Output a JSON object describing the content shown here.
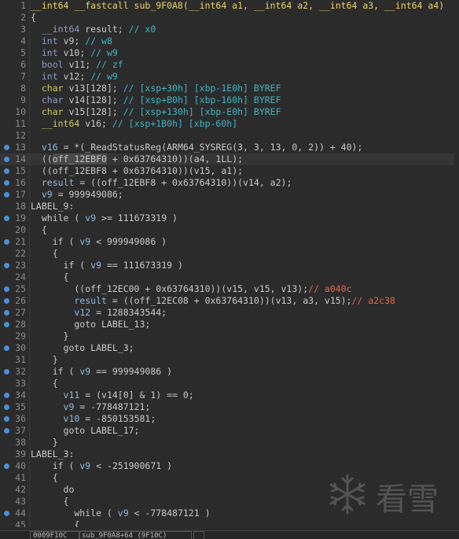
{
  "editor": {
    "lines": [
      {
        "n": "1",
        "dot": false,
        "hl": false,
        "tokens": [
          [
            "fn",
            "__int64 __fastcall sub_9F0A8(__int64 a1, __int64 a2, __int64 a3, __int64 a4)"
          ]
        ]
      },
      {
        "n": "2",
        "dot": false,
        "hl": false,
        "tokens": [
          [
            "",
            "{"
          ]
        ]
      },
      {
        "n": "3",
        "dot": false,
        "hl": false,
        "tokens": [
          [
            "",
            "  "
          ],
          [
            "ty",
            "__int64"
          ],
          [
            "",
            " result; "
          ],
          [
            "cmt",
            "// x0"
          ]
        ]
      },
      {
        "n": "4",
        "dot": false,
        "hl": false,
        "tokens": [
          [
            "",
            "  "
          ],
          [
            "ty",
            "int"
          ],
          [
            "",
            " v9; "
          ],
          [
            "cmt",
            "// w8"
          ]
        ]
      },
      {
        "n": "5",
        "dot": false,
        "hl": false,
        "tokens": [
          [
            "",
            "  "
          ],
          [
            "ty",
            "int"
          ],
          [
            "",
            " v10; "
          ],
          [
            "cmt",
            "// w9"
          ]
        ]
      },
      {
        "n": "6",
        "dot": false,
        "hl": false,
        "tokens": [
          [
            "",
            "  "
          ],
          [
            "ty",
            "bool"
          ],
          [
            "",
            " v11; "
          ],
          [
            "cmt",
            "// zf"
          ]
        ]
      },
      {
        "n": "7",
        "dot": false,
        "hl": false,
        "tokens": [
          [
            "",
            "  "
          ],
          [
            "ty",
            "int"
          ],
          [
            "",
            " v12; "
          ],
          [
            "cmt",
            "// w9"
          ]
        ]
      },
      {
        "n": "8",
        "dot": false,
        "hl": false,
        "tokens": [
          [
            "",
            "  "
          ],
          [
            "kw",
            "char"
          ],
          [
            "",
            " v13[128]; "
          ],
          [
            "cmt",
            "// [xsp+30h] [xbp-1E0h] BYREF"
          ]
        ]
      },
      {
        "n": "9",
        "dot": false,
        "hl": false,
        "tokens": [
          [
            "",
            "  "
          ],
          [
            "ty",
            "char"
          ],
          [
            "",
            " v14[128]; "
          ],
          [
            "cmt",
            "// [xsp+B0h] [xbp-160h] BYREF"
          ]
        ]
      },
      {
        "n": "10",
        "dot": false,
        "hl": false,
        "tokens": [
          [
            "",
            "  "
          ],
          [
            "kw",
            "char"
          ],
          [
            "",
            " v15[128]; "
          ],
          [
            "cmt",
            "// [xsp+130h] [xbp-E0h] BYREF"
          ]
        ]
      },
      {
        "n": "11",
        "dot": false,
        "hl": false,
        "tokens": [
          [
            "",
            "  "
          ],
          [
            "kw",
            "__int64"
          ],
          [
            "",
            " v16; "
          ],
          [
            "cmt",
            "// [xsp+1B0h] [xbp-60h]"
          ]
        ]
      },
      {
        "n": "12",
        "dot": false,
        "hl": false,
        "tokens": [
          [
            "",
            ""
          ]
        ]
      },
      {
        "n": "13",
        "dot": true,
        "hl": false,
        "tokens": [
          [
            "",
            "  "
          ],
          [
            "var",
            "v16"
          ],
          [
            "",
            " = *("
          ],
          [
            "",
            "_ReadStatusReg"
          ],
          [
            "",
            "(ARM64_SYSREG(3, 3, 13, 0, 2)) + 40);"
          ]
        ]
      },
      {
        "n": "14",
        "dot": true,
        "hl": true,
        "tokens": [
          [
            "",
            "  (("
          ],
          [
            "sel",
            "off_12EBF0"
          ],
          [
            "",
            " + 0x63764310))(a4, 1LL);"
          ]
        ]
      },
      {
        "n": "15",
        "dot": true,
        "hl": false,
        "tokens": [
          [
            "",
            "  (("
          ],
          [
            "",
            "off_12EBF8"
          ],
          [
            "",
            " + 0x63764310))(v15, a1);"
          ]
        ]
      },
      {
        "n": "16",
        "dot": true,
        "hl": false,
        "tokens": [
          [
            "",
            "  "
          ],
          [
            "var",
            "result"
          ],
          [
            "",
            " = (("
          ],
          [
            "",
            "off_12EBF8"
          ],
          [
            "",
            " + 0x63764310))(v14, a2);"
          ]
        ]
      },
      {
        "n": "17",
        "dot": true,
        "hl": false,
        "tokens": [
          [
            "",
            "  "
          ],
          [
            "var",
            "v9"
          ],
          [
            "",
            " = 999949086;"
          ]
        ]
      },
      {
        "n": "18",
        "dot": false,
        "hl": false,
        "tokens": [
          [
            "",
            "LABEL_9:"
          ]
        ]
      },
      {
        "n": "19",
        "dot": true,
        "hl": false,
        "tokens": [
          [
            "",
            "  while ( "
          ],
          [
            "var",
            "v9"
          ],
          [
            "",
            " >= 111673319 )"
          ]
        ]
      },
      {
        "n": "20",
        "dot": false,
        "hl": false,
        "tokens": [
          [
            "",
            "  {"
          ]
        ]
      },
      {
        "n": "21",
        "dot": true,
        "hl": false,
        "tokens": [
          [
            "",
            "    if ( "
          ],
          [
            "var",
            "v9"
          ],
          [
            "",
            " < 999949086 )"
          ]
        ]
      },
      {
        "n": "22",
        "dot": false,
        "hl": false,
        "tokens": [
          [
            "",
            "    {"
          ]
        ]
      },
      {
        "n": "23",
        "dot": true,
        "hl": false,
        "tokens": [
          [
            "",
            "      if ( "
          ],
          [
            "var",
            "v9"
          ],
          [
            "",
            " == 111673319 )"
          ]
        ]
      },
      {
        "n": "24",
        "dot": false,
        "hl": false,
        "tokens": [
          [
            "",
            "      {"
          ]
        ]
      },
      {
        "n": "25",
        "dot": true,
        "hl": false,
        "tokens": [
          [
            "",
            "        (("
          ],
          [
            "",
            "off_12EC00"
          ],
          [
            "",
            " + 0x63764310))(v15, v15, v13);"
          ],
          [
            "red",
            "// a040c"
          ]
        ]
      },
      {
        "n": "26",
        "dot": true,
        "hl": false,
        "tokens": [
          [
            "",
            "        "
          ],
          [
            "var",
            "result"
          ],
          [
            "",
            " = (("
          ],
          [
            "",
            "off_12EC08"
          ],
          [
            "",
            " + 0x63764310))(v13, a3, v15);"
          ],
          [
            "red",
            "// a2c38"
          ]
        ]
      },
      {
        "n": "27",
        "dot": true,
        "hl": false,
        "tokens": [
          [
            "",
            "        "
          ],
          [
            "var",
            "v12"
          ],
          [
            "",
            " = 1288343544;"
          ]
        ]
      },
      {
        "n": "28",
        "dot": true,
        "hl": false,
        "tokens": [
          [
            "",
            "        goto LABEL_13;"
          ]
        ]
      },
      {
        "n": "29",
        "dot": false,
        "hl": false,
        "tokens": [
          [
            "",
            "      }"
          ]
        ]
      },
      {
        "n": "30",
        "dot": true,
        "hl": false,
        "tokens": [
          [
            "",
            "      goto LABEL_3;"
          ]
        ]
      },
      {
        "n": "31",
        "dot": false,
        "hl": false,
        "tokens": [
          [
            "",
            "    }"
          ]
        ]
      },
      {
        "n": "32",
        "dot": true,
        "hl": false,
        "tokens": [
          [
            "",
            "    if ( "
          ],
          [
            "var",
            "v9"
          ],
          [
            "",
            " == 999949086 )"
          ]
        ]
      },
      {
        "n": "33",
        "dot": false,
        "hl": false,
        "tokens": [
          [
            "",
            "    {"
          ]
        ]
      },
      {
        "n": "34",
        "dot": true,
        "hl": false,
        "tokens": [
          [
            "",
            "      "
          ],
          [
            "var",
            "v11"
          ],
          [
            "",
            " = (v14[0] & 1) == 0;"
          ]
        ]
      },
      {
        "n": "35",
        "dot": true,
        "hl": false,
        "tokens": [
          [
            "",
            "      "
          ],
          [
            "var",
            "v9"
          ],
          [
            "",
            " = -778487121;"
          ]
        ]
      },
      {
        "n": "36",
        "dot": true,
        "hl": false,
        "tokens": [
          [
            "",
            "      "
          ],
          [
            "var",
            "v10"
          ],
          [
            "",
            " = -850153581;"
          ]
        ]
      },
      {
        "n": "37",
        "dot": true,
        "hl": false,
        "tokens": [
          [
            "",
            "      goto LABEL_17;"
          ]
        ]
      },
      {
        "n": "38",
        "dot": false,
        "hl": false,
        "tokens": [
          [
            "",
            "    }"
          ]
        ]
      },
      {
        "n": "39",
        "dot": false,
        "hl": false,
        "tokens": [
          [
            "",
            "LABEL_3:"
          ]
        ]
      },
      {
        "n": "40",
        "dot": true,
        "hl": false,
        "tokens": [
          [
            "",
            "    if ( "
          ],
          [
            "var",
            "v9"
          ],
          [
            "",
            " < -251900671 )"
          ]
        ]
      },
      {
        "n": "41",
        "dot": false,
        "hl": false,
        "tokens": [
          [
            "",
            "    {"
          ]
        ]
      },
      {
        "n": "42",
        "dot": false,
        "hl": false,
        "tokens": [
          [
            "",
            "      do"
          ]
        ]
      },
      {
        "n": "43",
        "dot": false,
        "hl": false,
        "tokens": [
          [
            "",
            "      {"
          ]
        ]
      },
      {
        "n": "44",
        "dot": true,
        "hl": false,
        "tokens": [
          [
            "",
            "        while ( "
          ],
          [
            "var",
            "v9"
          ],
          [
            "",
            " < -778487121 )"
          ]
        ]
      },
      {
        "n": "45",
        "dot": false,
        "hl": false,
        "tokens": [
          [
            "",
            "        {"
          ]
        ]
      }
    ]
  },
  "statusbar": {
    "address": "0009F10C",
    "location": "sub_9F0A8+64 (9F10C)"
  },
  "watermark": {
    "icon": "snowflake-icon",
    "text": "看雪"
  },
  "colors": {
    "background": "#2b2b2b",
    "function_signature": "#e7d46a",
    "comment": "#3fb4c4",
    "annotation_comment": "#e0674e",
    "variable": "#91b8e0",
    "breakpoint_dot": "#4a8fd6"
  }
}
